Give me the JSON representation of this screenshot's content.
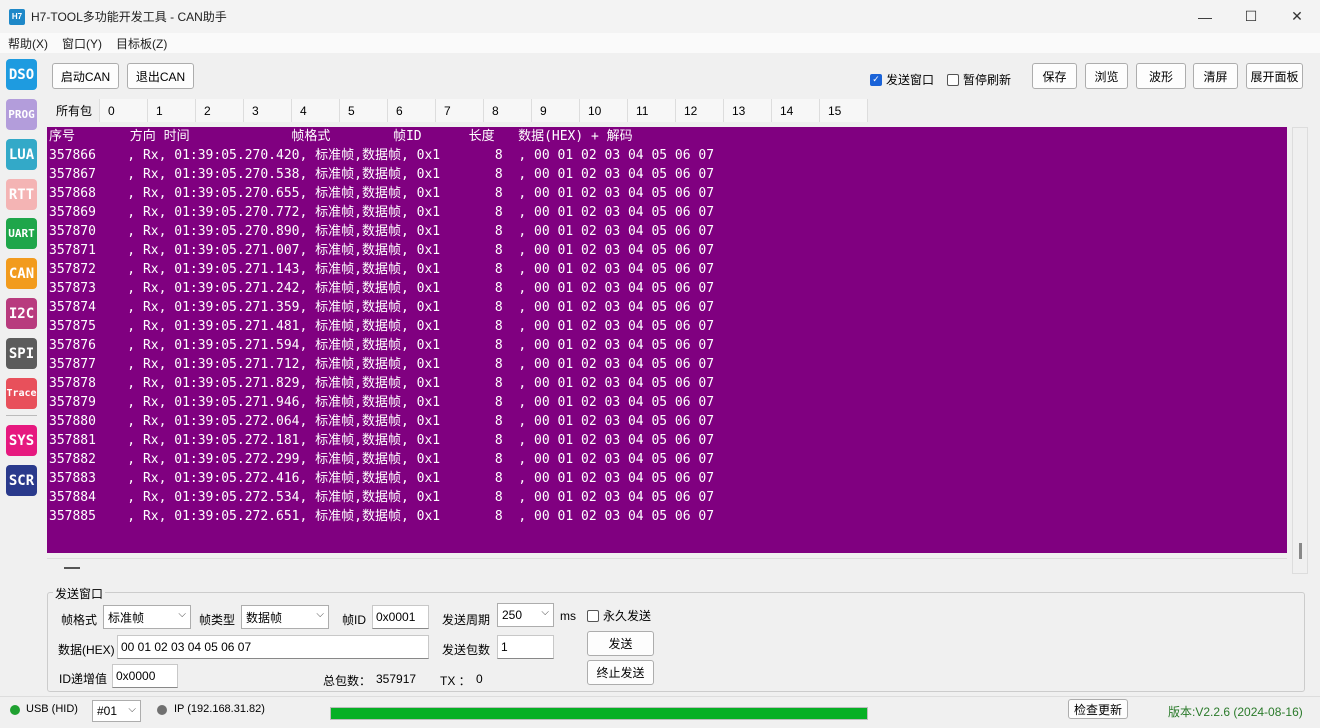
{
  "window": {
    "icon_text": "H7",
    "title": "H7-TOOL多功能开发工具 - CAN助手",
    "minimize": "—",
    "maximize": "☐",
    "close": "✕"
  },
  "menu": [
    "帮助(X)",
    "窗口(Y)",
    "目标板(Z)"
  ],
  "sidebar": [
    {
      "label": "DSO",
      "color": "#1e9be0"
    },
    {
      "label": "PROG",
      "color": "#b39ddb"
    },
    {
      "label": "LUA",
      "color": "#33a9c8"
    },
    {
      "label": "RTT",
      "color": "#f4b4b4"
    },
    {
      "label": "UART",
      "color": "#1fa64a"
    },
    {
      "label": "CAN",
      "color": "#f29b1d"
    },
    {
      "label": "I2C",
      "color": "#b83b7e"
    },
    {
      "label": "SPI",
      "color": "#5c5c5c"
    },
    {
      "label": "Trace",
      "color": "#e8505b"
    },
    {
      "label": "SYS",
      "color": "#e6197f"
    },
    {
      "label": "SCR",
      "color": "#2a3a8c"
    }
  ],
  "toolbar": {
    "start_can": "启动CAN",
    "exit_can": "退出CAN",
    "send_window": "发送窗口",
    "send_window_checked": true,
    "pause_refresh": "暂停刷新",
    "pause_refresh_checked": false,
    "save": "保存",
    "browse": "浏览",
    "wave": "波形",
    "clear": "清屏",
    "expand_panel": "展开面板"
  },
  "tabs": [
    "所有包",
    "0",
    "1",
    "2",
    "3",
    "4",
    "5",
    "6",
    "7",
    "8",
    "9",
    "10",
    "11",
    "12",
    "13",
    "14",
    "15"
  ],
  "log": {
    "header": "序号       方向 时间             帧格式        帧ID      长度   数据(HEX) + 解码",
    "rows": [
      {
        "seq": "357866",
        "dir": "Rx",
        "time": "01:39:05.270.420",
        "fmt": "标准帧,数据帧",
        "id": "0x1",
        "len": "8",
        "data": "00 01 02 03 04 05 06 07"
      },
      {
        "seq": "357867",
        "dir": "Rx",
        "time": "01:39:05.270.538",
        "fmt": "标准帧,数据帧",
        "id": "0x1",
        "len": "8",
        "data": "00 01 02 03 04 05 06 07"
      },
      {
        "seq": "357868",
        "dir": "Rx",
        "time": "01:39:05.270.655",
        "fmt": "标准帧,数据帧",
        "id": "0x1",
        "len": "8",
        "data": "00 01 02 03 04 05 06 07"
      },
      {
        "seq": "357869",
        "dir": "Rx",
        "time": "01:39:05.270.772",
        "fmt": "标准帧,数据帧",
        "id": "0x1",
        "len": "8",
        "data": "00 01 02 03 04 05 06 07"
      },
      {
        "seq": "357870",
        "dir": "Rx",
        "time": "01:39:05.270.890",
        "fmt": "标准帧,数据帧",
        "id": "0x1",
        "len": "8",
        "data": "00 01 02 03 04 05 06 07"
      },
      {
        "seq": "357871",
        "dir": "Rx",
        "time": "01:39:05.271.007",
        "fmt": "标准帧,数据帧",
        "id": "0x1",
        "len": "8",
        "data": "00 01 02 03 04 05 06 07"
      },
      {
        "seq": "357872",
        "dir": "Rx",
        "time": "01:39:05.271.143",
        "fmt": "标准帧,数据帧",
        "id": "0x1",
        "len": "8",
        "data": "00 01 02 03 04 05 06 07"
      },
      {
        "seq": "357873",
        "dir": "Rx",
        "time": "01:39:05.271.242",
        "fmt": "标准帧,数据帧",
        "id": "0x1",
        "len": "8",
        "data": "00 01 02 03 04 05 06 07"
      },
      {
        "seq": "357874",
        "dir": "Rx",
        "time": "01:39:05.271.359",
        "fmt": "标准帧,数据帧",
        "id": "0x1",
        "len": "8",
        "data": "00 01 02 03 04 05 06 07"
      },
      {
        "seq": "357875",
        "dir": "Rx",
        "time": "01:39:05.271.481",
        "fmt": "标准帧,数据帧",
        "id": "0x1",
        "len": "8",
        "data": "00 01 02 03 04 05 06 07"
      },
      {
        "seq": "357876",
        "dir": "Rx",
        "time": "01:39:05.271.594",
        "fmt": "标准帧,数据帧",
        "id": "0x1",
        "len": "8",
        "data": "00 01 02 03 04 05 06 07"
      },
      {
        "seq": "357877",
        "dir": "Rx",
        "time": "01:39:05.271.712",
        "fmt": "标准帧,数据帧",
        "id": "0x1",
        "len": "8",
        "data": "00 01 02 03 04 05 06 07"
      },
      {
        "seq": "357878",
        "dir": "Rx",
        "time": "01:39:05.271.829",
        "fmt": "标准帧,数据帧",
        "id": "0x1",
        "len": "8",
        "data": "00 01 02 03 04 05 06 07"
      },
      {
        "seq": "357879",
        "dir": "Rx",
        "time": "01:39:05.271.946",
        "fmt": "标准帧,数据帧",
        "id": "0x1",
        "len": "8",
        "data": "00 01 02 03 04 05 06 07"
      },
      {
        "seq": "357880",
        "dir": "Rx",
        "time": "01:39:05.272.064",
        "fmt": "标准帧,数据帧",
        "id": "0x1",
        "len": "8",
        "data": "00 01 02 03 04 05 06 07"
      },
      {
        "seq": "357881",
        "dir": "Rx",
        "time": "01:39:05.272.181",
        "fmt": "标准帧,数据帧",
        "id": "0x1",
        "len": "8",
        "data": "00 01 02 03 04 05 06 07"
      },
      {
        "seq": "357882",
        "dir": "Rx",
        "time": "01:39:05.272.299",
        "fmt": "标准帧,数据帧",
        "id": "0x1",
        "len": "8",
        "data": "00 01 02 03 04 05 06 07"
      },
      {
        "seq": "357883",
        "dir": "Rx",
        "time": "01:39:05.272.416",
        "fmt": "标准帧,数据帧",
        "id": "0x1",
        "len": "8",
        "data": "00 01 02 03 04 05 06 07"
      },
      {
        "seq": "357884",
        "dir": "Rx",
        "time": "01:39:05.272.534",
        "fmt": "标准帧,数据帧",
        "id": "0x1",
        "len": "8",
        "data": "00 01 02 03 04 05 06 07"
      },
      {
        "seq": "357885",
        "dir": "Rx",
        "time": "01:39:05.272.651",
        "fmt": "标准帧,数据帧",
        "id": "0x1",
        "len": "8",
        "data": "00 01 02 03 04 05 06 07"
      }
    ],
    "background": "#800080"
  },
  "send": {
    "group_title": "发送窗口",
    "frame_format_label": "帧格式",
    "frame_format_value": "标准帧",
    "frame_type_label": "帧类型",
    "frame_type_value": "数据帧",
    "frame_id_label": "帧ID",
    "frame_id_value": "0x0001",
    "period_label": "发送周期",
    "period_value": "250",
    "period_unit": "ms",
    "forever_label": "永久发送",
    "forever_checked": false,
    "data_label": "数据(HEX)",
    "data_value": "00 01 02 03 04 05 06 07",
    "count_label": "发送包数",
    "count_value": "1",
    "send_button": "发送",
    "stop_button": "终止发送",
    "id_inc_label": "ID递增值",
    "id_inc_value": "0x0000",
    "total_label": "总包数：",
    "total_value": "357917",
    "tx_label": "TX ：",
    "tx_value": "0"
  },
  "status": {
    "usb_label": "USB (HID)",
    "usb_color": "#1fa030",
    "device_select": "#01",
    "ip_label": "IP (192.168.31.82)",
    "ip_color": "#707070",
    "progress_fraction": 1.0,
    "check_update": "检查更新",
    "version": "版本:V2.2.6 (2024-08-16)",
    "version_color": "#2a7a2a"
  }
}
